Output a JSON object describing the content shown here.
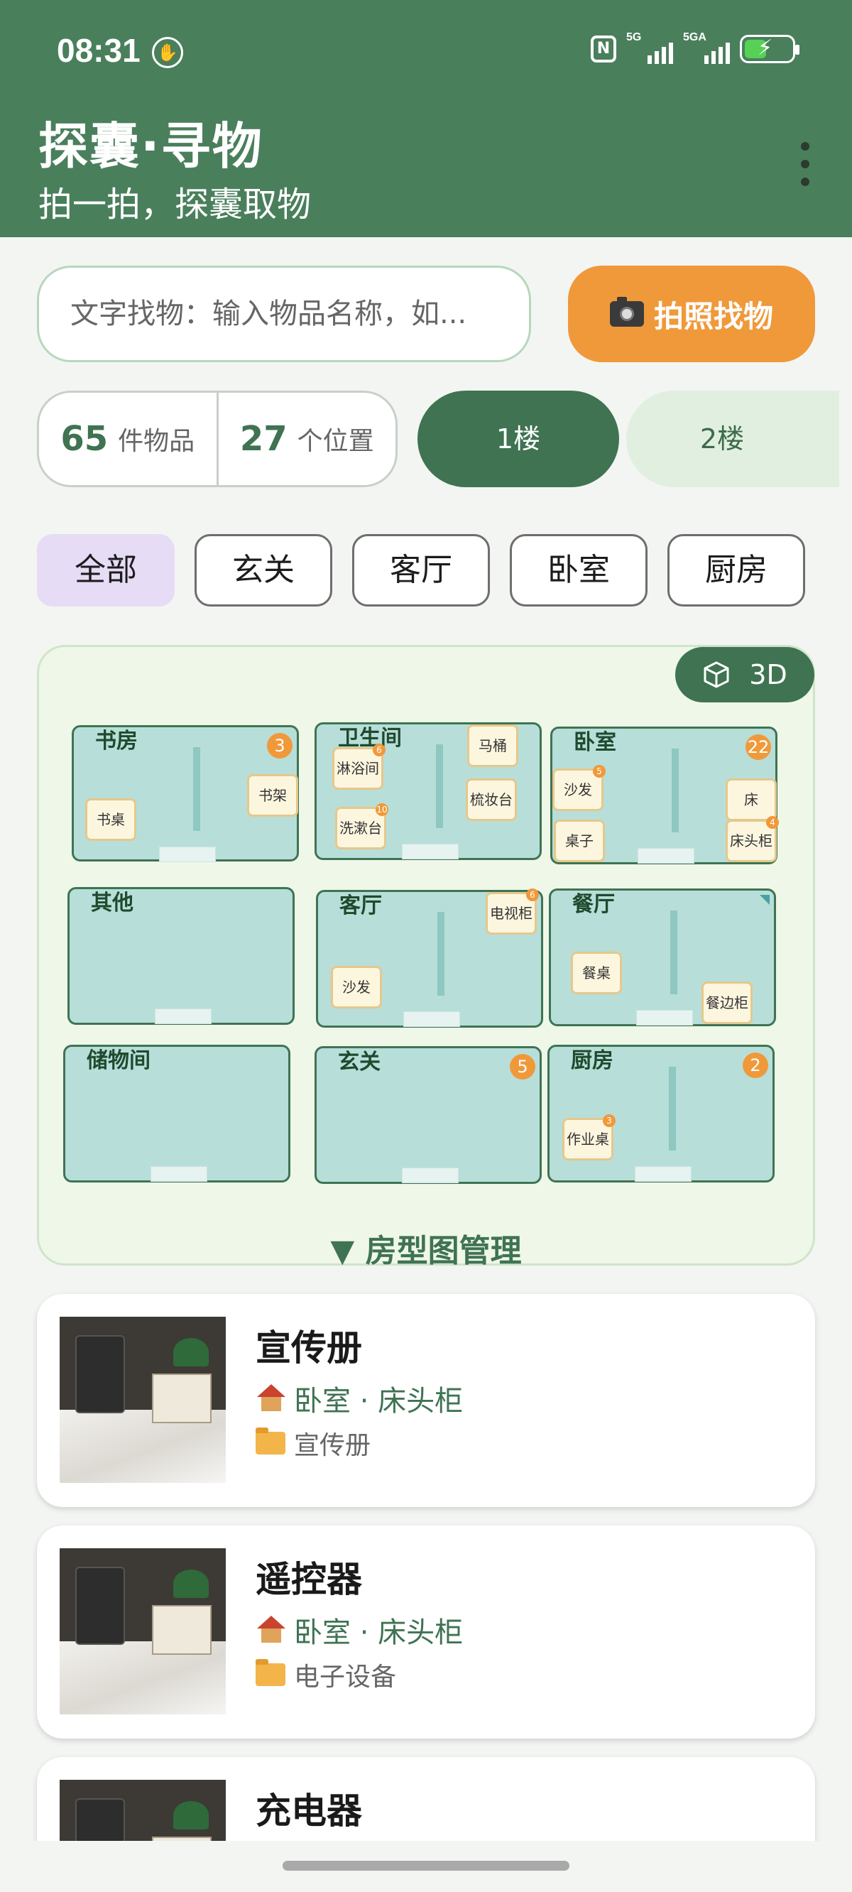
{
  "status_bar": {
    "time": "08:31",
    "net1": "5G",
    "net2": "5GA"
  },
  "header": {
    "title": "探囊·寻物",
    "subtitle": "拍一拍，探囊取物"
  },
  "search": {
    "placeholder": "文字找物：输入物品名称，如...",
    "photo_button": "拍照找物"
  },
  "stats": {
    "items_count": "65",
    "items_unit": "件物品",
    "locations_count": "27",
    "locations_unit": "个位置"
  },
  "floors": [
    "1楼",
    "2楼"
  ],
  "room_filters": [
    "全部",
    "玄关",
    "客厅",
    "卧室",
    "厨房"
  ],
  "floor_plan": {
    "btn_3d": "3D",
    "manage_label": "▼ 房型图管理",
    "rooms": {
      "study": {
        "name": "书房",
        "badge": "3",
        "furniture": [
          "书桌",
          "书架"
        ]
      },
      "bathroom": {
        "name": "卫生间",
        "furniture": [
          "马桶",
          "淋浴间",
          "梳妆台",
          "洗漱台"
        ],
        "counts": {
          "shower": "6",
          "washbasin": "10"
        }
      },
      "bedroom": {
        "name": "卧室",
        "badge": "22",
        "furniture": [
          "沙发",
          "床",
          "桌子",
          "床头柜"
        ],
        "counts": {
          "sofa": "5",
          "nightstand": "4"
        }
      },
      "other": {
        "name": "其他"
      },
      "living": {
        "name": "客厅",
        "furniture": [
          "电视柜",
          "沙发"
        ],
        "counts": {
          "tv": "6"
        }
      },
      "dining": {
        "name": "餐厅",
        "furniture": [
          "餐桌",
          "餐边柜"
        ]
      },
      "storage": {
        "name": "储物间"
      },
      "entry": {
        "name": "玄关",
        "badge": "5"
      },
      "kitchen": {
        "name": "厨房",
        "badge": "2",
        "furniture": [
          "作业桌"
        ],
        "counts": {
          "desk": "3"
        }
      }
    }
  },
  "items": [
    {
      "title": "宣传册",
      "location": "卧室 · 床头柜",
      "category": "宣传册"
    },
    {
      "title": "遥控器",
      "location": "卧室 · 床头柜",
      "category": "电子设备"
    },
    {
      "title": "充电器",
      "location": "",
      "category": ""
    }
  ],
  "colors": {
    "header_green": "#4a7f5c",
    "accent_orange": "#f0993a",
    "room_fill": "#b8ded9"
  }
}
